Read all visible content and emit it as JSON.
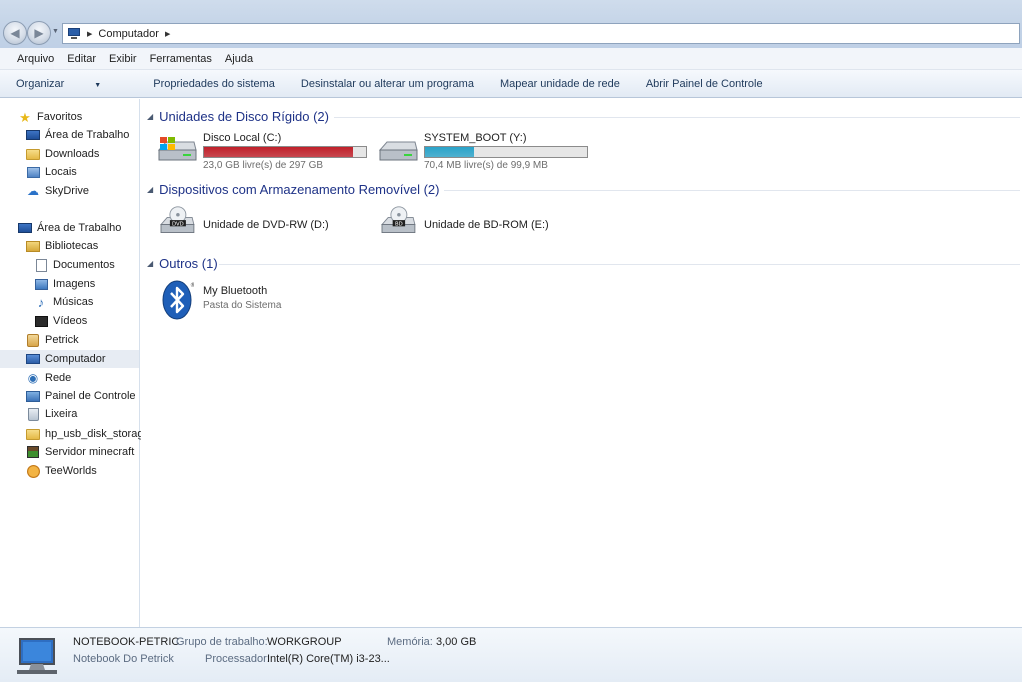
{
  "address_bar": {
    "path": [
      "Computador"
    ]
  },
  "menu": [
    "Arquivo",
    "Editar",
    "Exibir",
    "Ferramentas",
    "Ajuda"
  ],
  "commands": {
    "organize": "Organizar",
    "items": [
      "Propriedades do sistema",
      "Desinstalar ou alterar um programa",
      "Mapear unidade de rede",
      "Abrir Painel de Controle"
    ]
  },
  "sidebar": {
    "favorites": {
      "label": "Favoritos",
      "items": [
        "Área de Trabalho",
        "Downloads",
        "Locais",
        "SkyDrive"
      ]
    },
    "desktop": {
      "label": "Área de Trabalho",
      "libraries": {
        "label": "Bibliotecas",
        "items": [
          "Documentos",
          "Imagens",
          "Músicas",
          "Vídeos"
        ]
      },
      "items": [
        "Petrick",
        "Computador",
        "Rede",
        "Painel de Controle",
        "Lixeira",
        "hp_usb_disk_storage",
        "Servidor minecraft",
        "TeeWorlds"
      ]
    },
    "selected": "Computador"
  },
  "groups": {
    "hard_disks": {
      "title": "Unidades de Disco Rígido (2)",
      "drives": [
        {
          "name": "Disco Local (C:)",
          "free_text": "23,0 GB livre(s) de 297 GB",
          "used_fraction": 0.92,
          "bar_color": "#c0202a"
        },
        {
          "name": "SYSTEM_BOOT (Y:)",
          "free_text": "70,4 MB livre(s) de 99,9 MB",
          "used_fraction": 0.3,
          "bar_color": "#2aa3c9"
        }
      ]
    },
    "removable": {
      "title": "Dispositivos com Armazenamento Removível (2)",
      "devices": [
        {
          "name": "Unidade de DVD-RW (D:)",
          "badge": "DVD"
        },
        {
          "name": "Unidade de BD-ROM (E:)",
          "badge": "BD"
        }
      ]
    },
    "other": {
      "title": "Outros (1)",
      "items": [
        {
          "name": "My Bluetooth",
          "sub": "Pasta do Sistema"
        }
      ]
    }
  },
  "details": {
    "computer_name": "NOTEBOOK-PETRIC",
    "description": "Notebook Do Petrick",
    "workgroup_label": "Grupo de trabalho:",
    "workgroup_value": "WORKGROUP",
    "memory_label": "Memória:",
    "memory_value": "3,00 GB",
    "processor_label": "Processador:",
    "processor_value": "Intel(R) Core(TM) i3-23..."
  }
}
